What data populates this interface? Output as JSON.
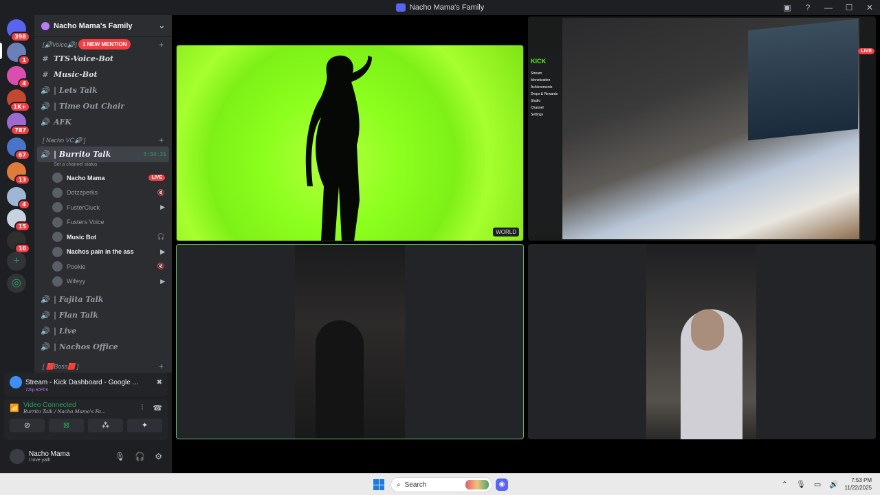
{
  "window": {
    "title": "Nacho Mama's Family",
    "controls": [
      "—",
      "☐",
      "✕"
    ]
  },
  "servers": [
    {
      "badge": "398"
    },
    {
      "badge": "1"
    },
    {
      "badge": "4"
    },
    {
      "badge": "1K+"
    },
    {
      "badge": "787"
    },
    {
      "badge": "67"
    },
    {
      "badge": "13"
    },
    {
      "badge": "4"
    },
    {
      "badge": "15"
    },
    {
      "badge": "10"
    }
  ],
  "guild": {
    "name": "Nacho Mama's Family"
  },
  "categories": {
    "voice": "[🔊Voice🔊]",
    "nacho_vc": "[ Nacho VC🔊 ]",
    "boss": "[ 🟥Boss🟥 ]",
    "mention": "1 NEW MENTION"
  },
  "channels_top": [
    {
      "icon": "#",
      "name": "TTS-Voice-Bot"
    },
    {
      "icon": "#",
      "name": "Music-Bot"
    },
    {
      "icon": "🔊",
      "name": "| Lets Talk"
    },
    {
      "icon": "🔊",
      "name": "| Time Out Chair"
    },
    {
      "icon": "🔊",
      "name": "AFK"
    }
  ],
  "active_channel": {
    "name": "| Burrito Talk",
    "time": "3:34:31",
    "status": "Set a channel status"
  },
  "voice_users": [
    {
      "name": "Nacho Mama",
      "tag": "LIVE"
    },
    {
      "name": "Dotzzperks",
      "icon": "🔇"
    },
    {
      "name": "FusterCluck",
      "icon": "▶"
    },
    {
      "name": "Fusters Voice",
      "icon": ""
    },
    {
      "name": "Music Bot",
      "icon": "🎧"
    },
    {
      "name": "Nachos pain in the ass",
      "icon": "▶"
    },
    {
      "name": "Pookie",
      "icon": "🔇"
    },
    {
      "name": "Wifeyy",
      "icon": "▶"
    }
  ],
  "channels_bottom": [
    {
      "name": "| Fajita Talk"
    },
    {
      "name": "| Flan Talk"
    },
    {
      "name": "| Live"
    },
    {
      "name": "| Nachos Office"
    }
  ],
  "stream_panel": {
    "title": "Stream - Kick Dashboard - Google ...",
    "quality": "720p 60FPS"
  },
  "voice_panel": {
    "status": "Video Connected",
    "location": "Burrito Talk / Nacho Mama's Fa..."
  },
  "user": {
    "name": "Nacho Mama",
    "status": "I love yall!"
  },
  "stage": {
    "world_tag": "WORLD",
    "kick_brand": "KICK",
    "live_tag": "LIVE",
    "kick_menu": [
      "Stream",
      "Monetization",
      "Achievements",
      "Drops & Rewards",
      "Studio",
      "Channel",
      "Settings"
    ]
  },
  "taskbar": {
    "search_placeholder": "Search",
    "time": "7:53 PM",
    "date": "11/22/2025"
  }
}
